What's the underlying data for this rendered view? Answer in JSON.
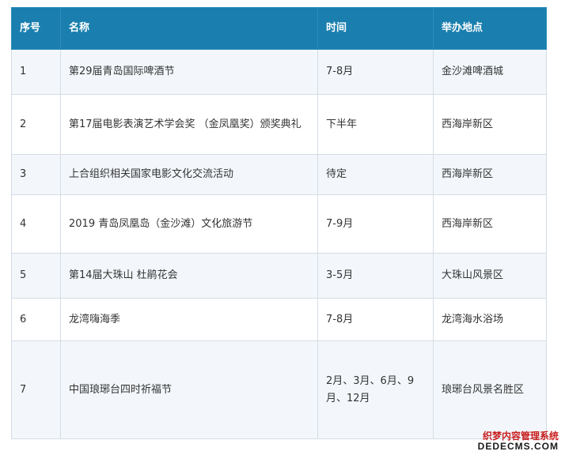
{
  "table": {
    "headers": [
      "序号",
      "名称",
      "时间",
      "举办地点"
    ],
    "rows": [
      {
        "no": "1",
        "name": "第29届青岛国际啤酒节",
        "time": "7-8月",
        "place": "金沙滩啤酒城"
      },
      {
        "no": "2",
        "name": "第17届电影表演艺术学会奖 （金凤凰奖）颁奖典礼",
        "time": "下半年",
        "place": "西海岸新区"
      },
      {
        "no": "3",
        "name": "上合组织相关国家电影文化交流活动",
        "time": "待定",
        "place": "西海岸新区"
      },
      {
        "no": "4",
        "name": "2019 青岛凤凰岛（金沙滩）文化旅游节",
        "time": "7-9月",
        "place": "西海岸新区"
      },
      {
        "no": "5",
        "name": "第14届大珠山 杜鹃花会",
        "time": "3-5月",
        "place": "大珠山风景区"
      },
      {
        "no": "6",
        "name": "龙湾嗨海季",
        "time": "7-8月",
        "place": "龙湾海水浴场"
      },
      {
        "no": "7",
        "name": "中国琅琊台四时祈福节",
        "time": "2月、3月、6月、9月、12月",
        "place": "琅琊台风景名胜区"
      }
    ]
  },
  "watermark": {
    "line1": "织梦内容管理系统",
    "line2": "DEDECMS.COM"
  },
  "colors": {
    "header_bg": "#1a7fae",
    "header_text": "#ffffff",
    "row_alt_bg": "#f3f7fb",
    "border": "#d4dce4"
  }
}
